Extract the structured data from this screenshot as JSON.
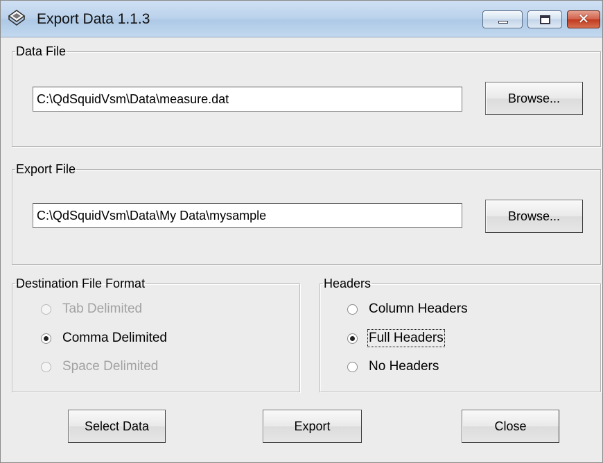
{
  "window": {
    "title": "Export Data 1.1.3",
    "controls": {
      "minimize": "",
      "maximize": "",
      "close": "✕"
    }
  },
  "data_file": {
    "label": "Data File",
    "path": "C:\\QdSquidVsm\\Data\\measure.dat",
    "browse_label": "Browse..."
  },
  "export_file": {
    "label": "Export File",
    "path": "C:\\QdSquidVsm\\Data\\My Data\\mysample",
    "browse_label": "Browse..."
  },
  "destination_format": {
    "label": "Destination File Format",
    "options": [
      {
        "label": "Tab Delimited",
        "checked": false,
        "enabled": false
      },
      {
        "label": "Comma Delimited",
        "checked": true,
        "enabled": true
      },
      {
        "label": "Space Delimited",
        "checked": false,
        "enabled": false
      }
    ]
  },
  "headers": {
    "label": "Headers",
    "options": [
      {
        "label": "Column Headers",
        "checked": false,
        "enabled": true
      },
      {
        "label": "Full Headers",
        "checked": true,
        "enabled": true
      },
      {
        "label": "No Headers",
        "checked": false,
        "enabled": true
      }
    ]
  },
  "actions": {
    "select_data": "Select Data",
    "export": "Export",
    "close": "Close"
  }
}
